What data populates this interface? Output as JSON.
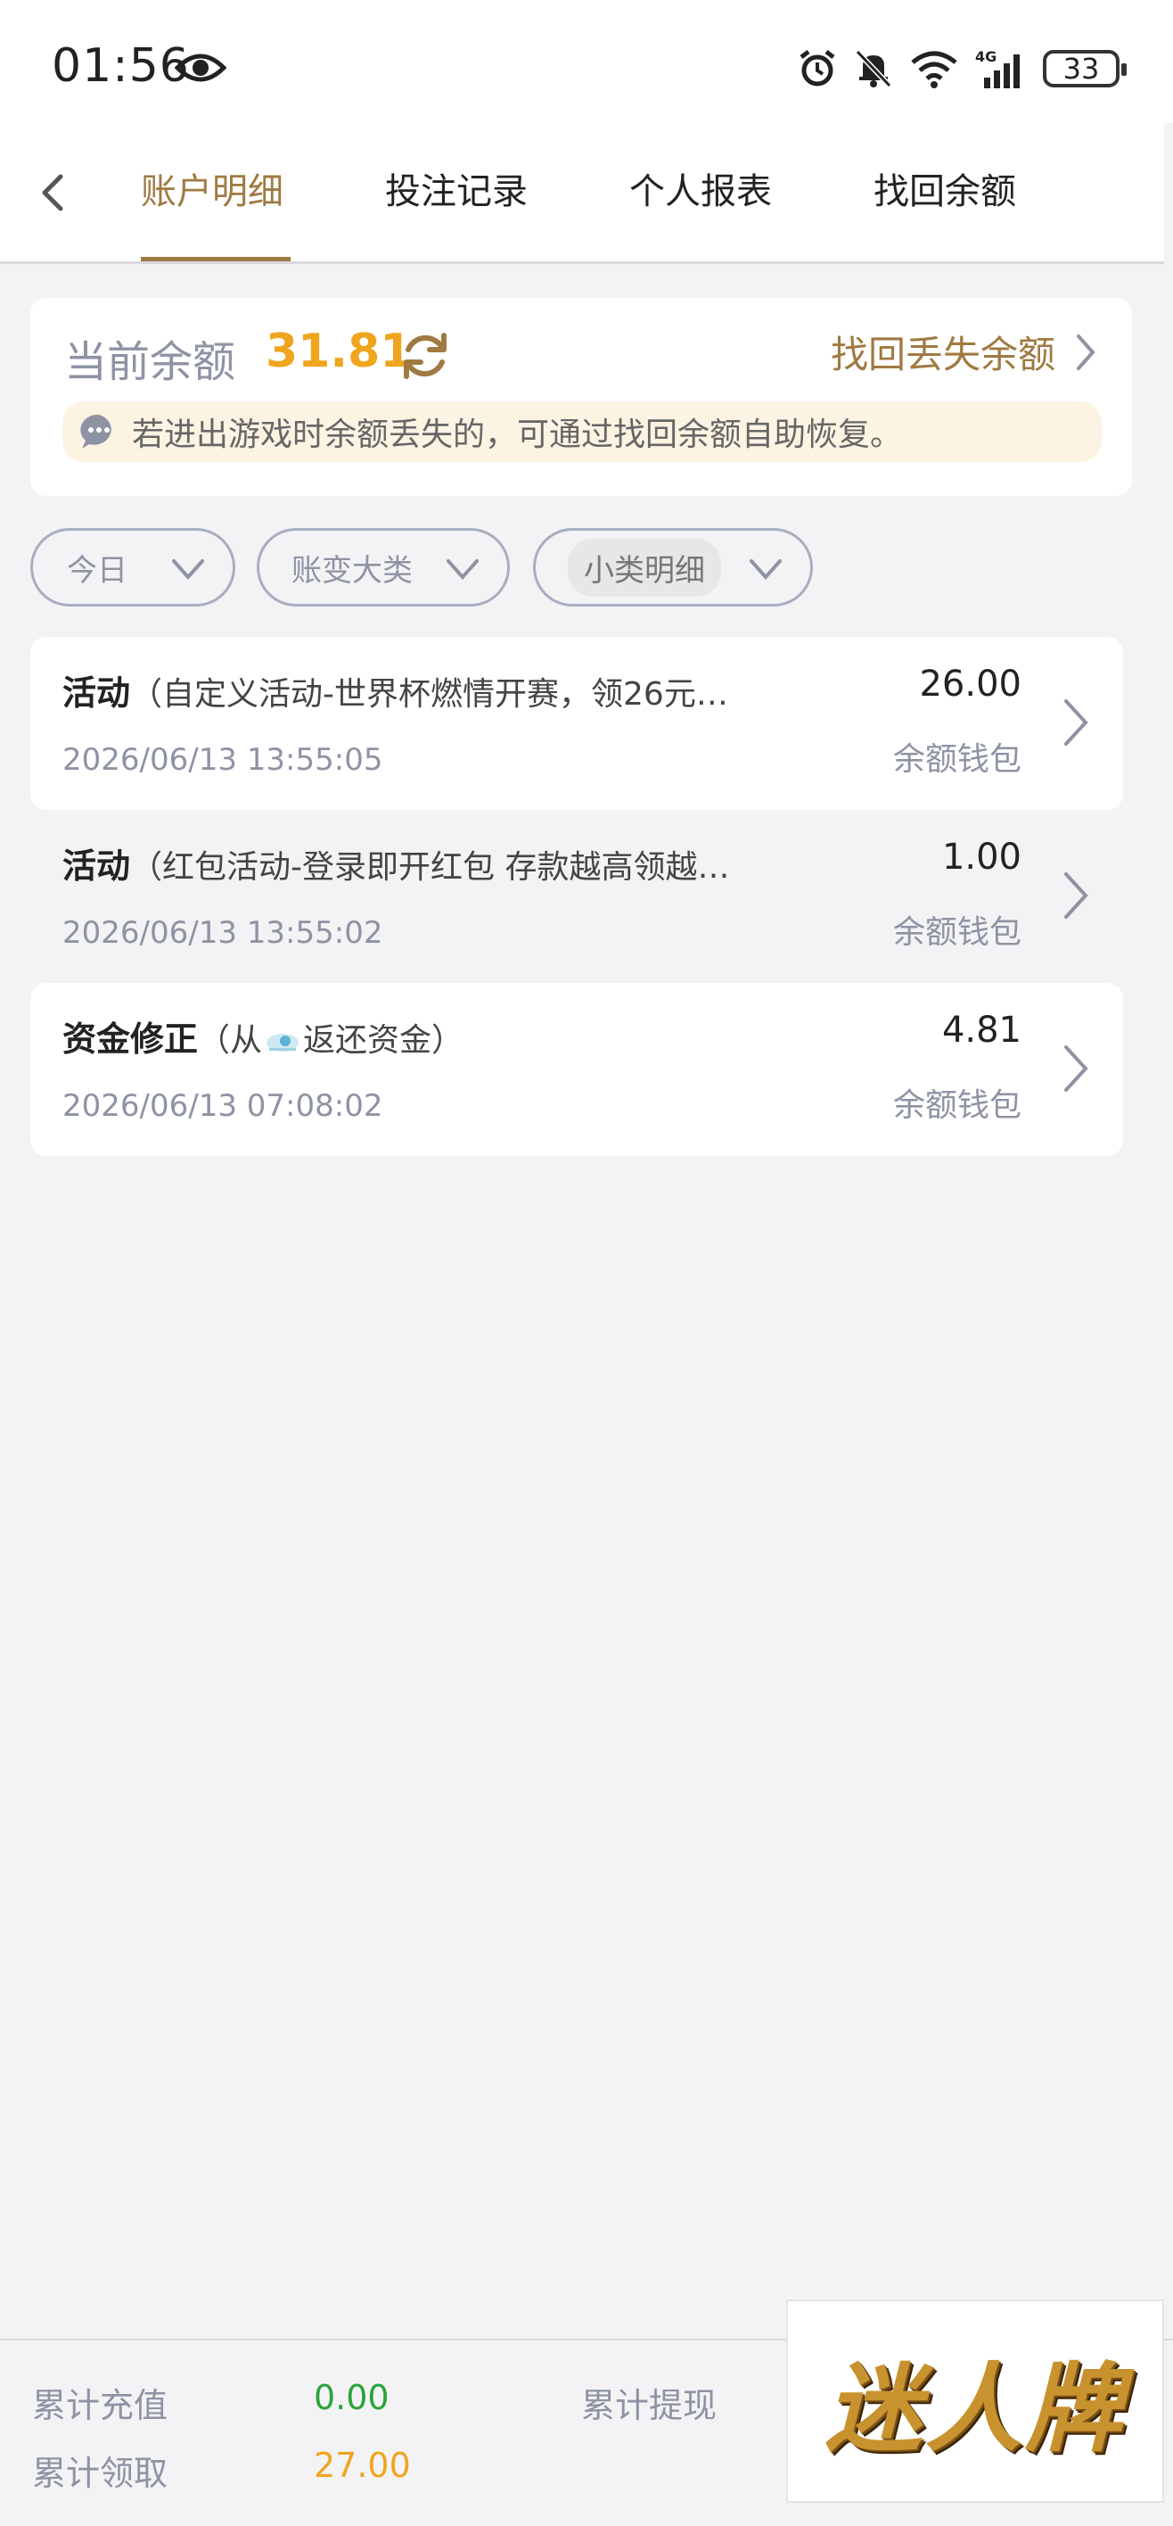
{
  "status_bar": {
    "time": "01:56",
    "battery": "33",
    "network": "4G"
  },
  "nav": {
    "tabs": [
      {
        "label": "账户明细",
        "active": true
      },
      {
        "label": "投注记录",
        "active": false
      },
      {
        "label": "个人报表",
        "active": false
      },
      {
        "label": "找回余额",
        "active": false
      }
    ]
  },
  "balance": {
    "label": "当前余额",
    "value": "31.81",
    "recover_link": "找回丢失余额",
    "notice": "若进出游戏时余额丢失的，可通过找回余额自助恢复。"
  },
  "filters": [
    {
      "label": "今日"
    },
    {
      "label": "账变大类"
    },
    {
      "label": "小类明细"
    }
  ],
  "records": [
    {
      "type": "活动",
      "detail": "（自定义活动-世界杯燃情开赛，领26元…",
      "date": "2026/06/13 13:55:05",
      "amount": "26.00",
      "wallet": "余额钱包"
    },
    {
      "type": "活动",
      "detail": "（红包活动-登录即开红包 存款越高领越…",
      "date": "2026/06/13 13:55:02",
      "amount": "1.00",
      "wallet": "余额钱包"
    },
    {
      "type": "资金修正",
      "detail_prefix": "（从",
      "detail_suffix": "返还资金）",
      "date": "2026/06/13 07:08:02",
      "amount": "4.81",
      "wallet": "余额钱包"
    }
  ],
  "summary": {
    "deposit_label": "累计充值",
    "deposit_value": "0.00",
    "withdraw_label": "累计提现",
    "claim_label": "累计领取",
    "claim_value": "27.00"
  },
  "logo": {
    "text": "迷人牌"
  },
  "colors": {
    "accent_gold": "#a07a42",
    "balance_orange": "#f0a51e",
    "deposit_green": "#2aa43a",
    "claim_orange": "#f0a51e",
    "muted_text": "#8e93a4"
  }
}
